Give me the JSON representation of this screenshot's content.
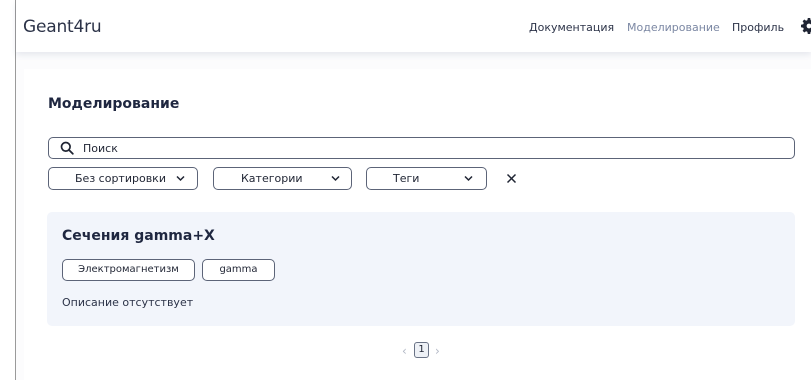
{
  "header": {
    "logo": "Geant4ru",
    "nav": {
      "docs": "Документация",
      "simulation": "Моделирование",
      "profile": "Профиль"
    },
    "settings_icon": "gear-icon",
    "active_color": "#7b87a3"
  },
  "main": {
    "title": "Моделирование",
    "search": {
      "placeholder": "Поиск",
      "value": "",
      "icon": "search-icon"
    },
    "filters": {
      "sort": "Без сортировки",
      "categories": "Категории",
      "tags": "Теги",
      "clear_icon": "close-icon"
    },
    "items": [
      {
        "title": "Сечения gamma+X",
        "tags": [
          "Электромагнетизм",
          "gamma"
        ],
        "description": "Описание отсутствует"
      }
    ],
    "pagination": {
      "prev": "‹",
      "current": "1",
      "next": "›"
    }
  }
}
